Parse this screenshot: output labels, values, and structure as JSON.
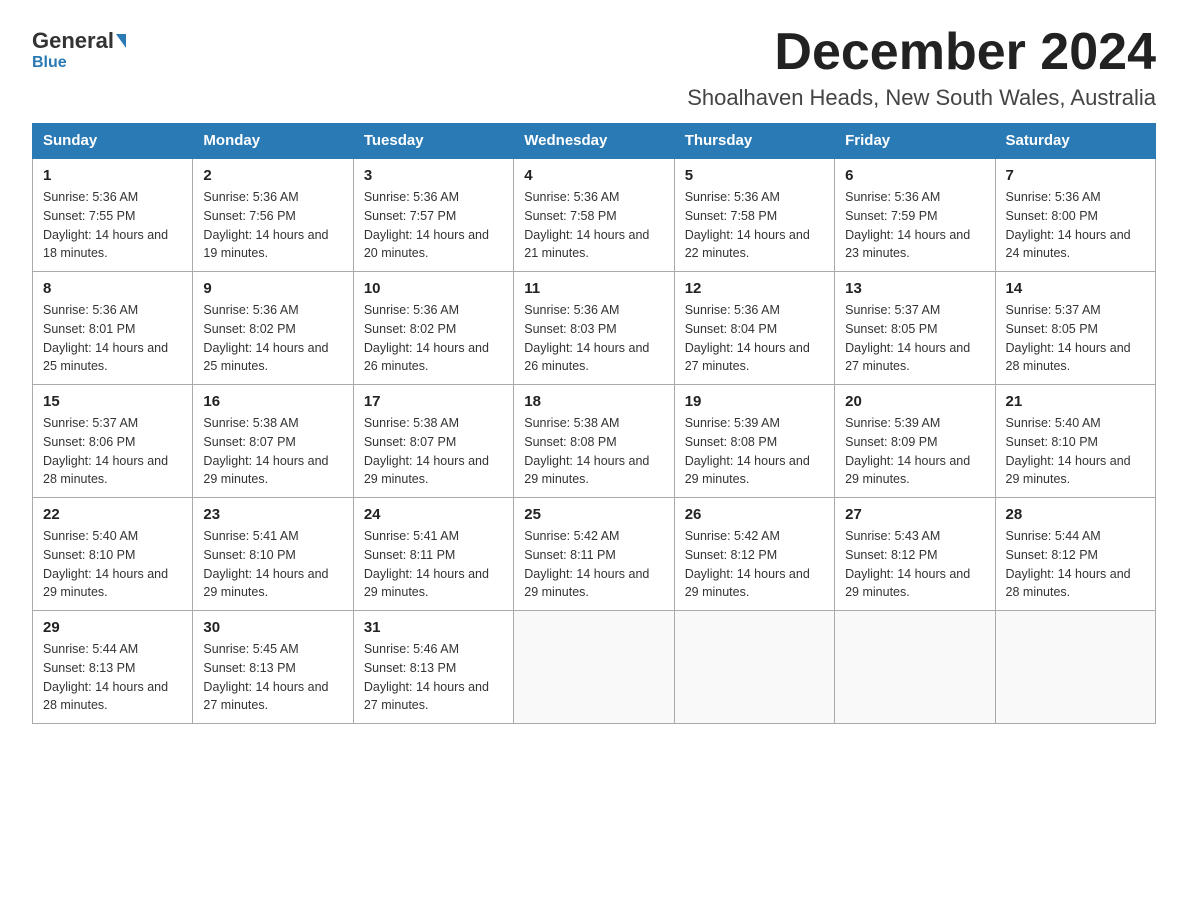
{
  "header": {
    "logo_general": "General",
    "logo_blue": "Blue",
    "month_title": "December 2024",
    "location": "Shoalhaven Heads, New South Wales, Australia"
  },
  "weekdays": [
    "Sunday",
    "Monday",
    "Tuesday",
    "Wednesday",
    "Thursday",
    "Friday",
    "Saturday"
  ],
  "weeks": [
    [
      {
        "day": "1",
        "sunrise": "5:36 AM",
        "sunset": "7:55 PM",
        "daylight": "14 hours and 18 minutes."
      },
      {
        "day": "2",
        "sunrise": "5:36 AM",
        "sunset": "7:56 PM",
        "daylight": "14 hours and 19 minutes."
      },
      {
        "day": "3",
        "sunrise": "5:36 AM",
        "sunset": "7:57 PM",
        "daylight": "14 hours and 20 minutes."
      },
      {
        "day": "4",
        "sunrise": "5:36 AM",
        "sunset": "7:58 PM",
        "daylight": "14 hours and 21 minutes."
      },
      {
        "day": "5",
        "sunrise": "5:36 AM",
        "sunset": "7:58 PM",
        "daylight": "14 hours and 22 minutes."
      },
      {
        "day": "6",
        "sunrise": "5:36 AM",
        "sunset": "7:59 PM",
        "daylight": "14 hours and 23 minutes."
      },
      {
        "day": "7",
        "sunrise": "5:36 AM",
        "sunset": "8:00 PM",
        "daylight": "14 hours and 24 minutes."
      }
    ],
    [
      {
        "day": "8",
        "sunrise": "5:36 AM",
        "sunset": "8:01 PM",
        "daylight": "14 hours and 25 minutes."
      },
      {
        "day": "9",
        "sunrise": "5:36 AM",
        "sunset": "8:02 PM",
        "daylight": "14 hours and 25 minutes."
      },
      {
        "day": "10",
        "sunrise": "5:36 AM",
        "sunset": "8:02 PM",
        "daylight": "14 hours and 26 minutes."
      },
      {
        "day": "11",
        "sunrise": "5:36 AM",
        "sunset": "8:03 PM",
        "daylight": "14 hours and 26 minutes."
      },
      {
        "day": "12",
        "sunrise": "5:36 AM",
        "sunset": "8:04 PM",
        "daylight": "14 hours and 27 minutes."
      },
      {
        "day": "13",
        "sunrise": "5:37 AM",
        "sunset": "8:05 PM",
        "daylight": "14 hours and 27 minutes."
      },
      {
        "day": "14",
        "sunrise": "5:37 AM",
        "sunset": "8:05 PM",
        "daylight": "14 hours and 28 minutes."
      }
    ],
    [
      {
        "day": "15",
        "sunrise": "5:37 AM",
        "sunset": "8:06 PM",
        "daylight": "14 hours and 28 minutes."
      },
      {
        "day": "16",
        "sunrise": "5:38 AM",
        "sunset": "8:07 PM",
        "daylight": "14 hours and 29 minutes."
      },
      {
        "day": "17",
        "sunrise": "5:38 AM",
        "sunset": "8:07 PM",
        "daylight": "14 hours and 29 minutes."
      },
      {
        "day": "18",
        "sunrise": "5:38 AM",
        "sunset": "8:08 PM",
        "daylight": "14 hours and 29 minutes."
      },
      {
        "day": "19",
        "sunrise": "5:39 AM",
        "sunset": "8:08 PM",
        "daylight": "14 hours and 29 minutes."
      },
      {
        "day": "20",
        "sunrise": "5:39 AM",
        "sunset": "8:09 PM",
        "daylight": "14 hours and 29 minutes."
      },
      {
        "day": "21",
        "sunrise": "5:40 AM",
        "sunset": "8:10 PM",
        "daylight": "14 hours and 29 minutes."
      }
    ],
    [
      {
        "day": "22",
        "sunrise": "5:40 AM",
        "sunset": "8:10 PM",
        "daylight": "14 hours and 29 minutes."
      },
      {
        "day": "23",
        "sunrise": "5:41 AM",
        "sunset": "8:10 PM",
        "daylight": "14 hours and 29 minutes."
      },
      {
        "day": "24",
        "sunrise": "5:41 AM",
        "sunset": "8:11 PM",
        "daylight": "14 hours and 29 minutes."
      },
      {
        "day": "25",
        "sunrise": "5:42 AM",
        "sunset": "8:11 PM",
        "daylight": "14 hours and 29 minutes."
      },
      {
        "day": "26",
        "sunrise": "5:42 AM",
        "sunset": "8:12 PM",
        "daylight": "14 hours and 29 minutes."
      },
      {
        "day": "27",
        "sunrise": "5:43 AM",
        "sunset": "8:12 PM",
        "daylight": "14 hours and 29 minutes."
      },
      {
        "day": "28",
        "sunrise": "5:44 AM",
        "sunset": "8:12 PM",
        "daylight": "14 hours and 28 minutes."
      }
    ],
    [
      {
        "day": "29",
        "sunrise": "5:44 AM",
        "sunset": "8:13 PM",
        "daylight": "14 hours and 28 minutes."
      },
      {
        "day": "30",
        "sunrise": "5:45 AM",
        "sunset": "8:13 PM",
        "daylight": "14 hours and 27 minutes."
      },
      {
        "day": "31",
        "sunrise": "5:46 AM",
        "sunset": "8:13 PM",
        "daylight": "14 hours and 27 minutes."
      },
      null,
      null,
      null,
      null
    ]
  ]
}
